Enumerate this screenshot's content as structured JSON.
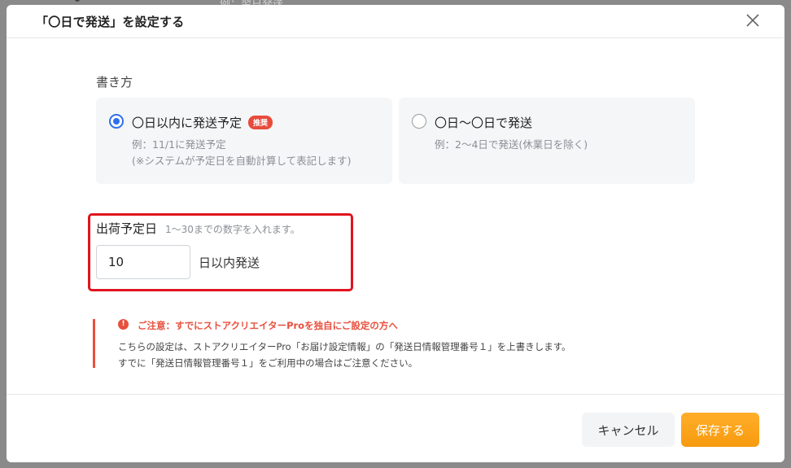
{
  "backdrop": {
    "text": "例：翌日発送"
  },
  "modal": {
    "title": "「〇日で発送」を設定する",
    "close_label": "×"
  },
  "format": {
    "label": "書き方",
    "options": [
      {
        "title": "〇日以内に発送予定",
        "badge": "推奨",
        "desc_line1": "例：11/1に発送予定",
        "desc_line2": "(※システムが予定日を自動計算して表記します)",
        "selected": true
      },
      {
        "title": "〇日〜〇日で発送",
        "desc_line1": "例：2〜4日で発送(休業日を除く)",
        "selected": false
      }
    ]
  },
  "shipping": {
    "label": "出荷予定日",
    "hint": "1〜30までの数字を入れます。",
    "value": "10",
    "suffix": "日以内発送"
  },
  "notice": {
    "title": "ご注意：すでにストアクリエイターProを独自にご設定の方へ",
    "line1": "こちらの設定は、ストアクリエイターPro「お届け設定情報」の「発送日情報管理番号１」を上書きします。",
    "line2": "すでに「発送日情報管理番号１」をご利用中の場合はご注意ください。"
  },
  "footer": {
    "cancel_label": "キャンセル",
    "save_label": "保存する"
  },
  "colors": {
    "accent": "#2f6fed",
    "warning": "#e8503e",
    "save": "#f79a0e",
    "highlight": "#e0141e"
  }
}
